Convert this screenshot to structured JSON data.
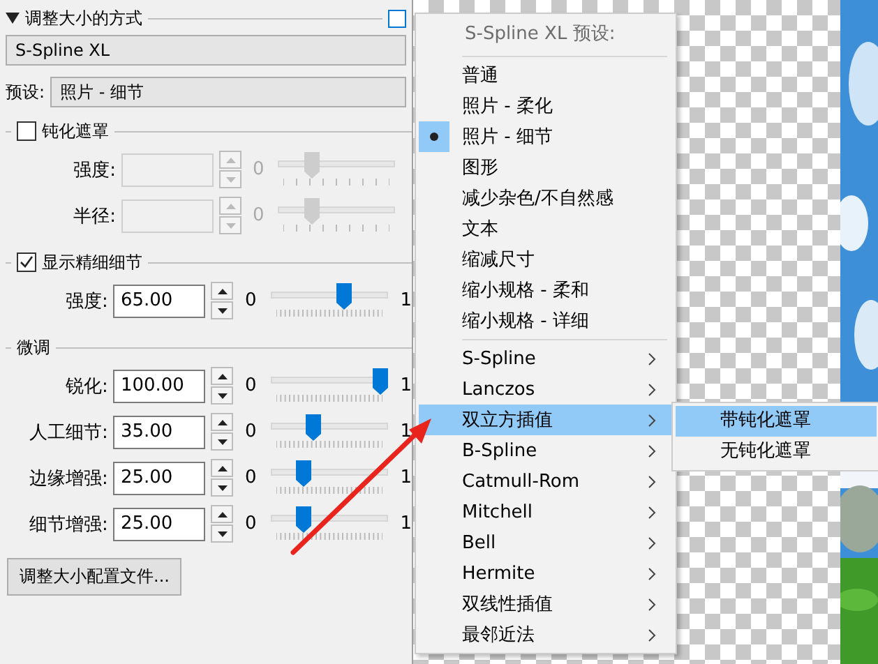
{
  "resize_method": {
    "title": "调整大小的方式",
    "method": "S-Spline XL"
  },
  "preset": {
    "label": "预设:",
    "value": "照片 - 细节"
  },
  "groups": [
    {
      "kind": "checkbox",
      "title": "钝化遮罩",
      "checked": false,
      "params": [
        {
          "label": "强度:",
          "min": "0",
          "level": 0.25,
          "disabled": true
        },
        {
          "label": "半径:",
          "min": "0",
          "level": 0.25,
          "disabled": true
        }
      ]
    },
    {
      "kind": "checkbox",
      "title": "显示精细细节",
      "checked": true,
      "params": [
        {
          "label": "强度:",
          "value": "65.00",
          "min": "0",
          "max": "1",
          "level": 0.65,
          "disabled": false
        }
      ]
    },
    {
      "kind": "plain",
      "title": "微调",
      "params": [
        {
          "label": "锐化:",
          "value": "100.00",
          "min": "0",
          "max": "1",
          "level": 1.0,
          "disabled": false
        },
        {
          "label": "人工细节:",
          "value": "35.00",
          "min": "0",
          "max": "1",
          "level": 0.35,
          "disabled": false
        },
        {
          "label": "边缘增强:",
          "value": "25.00",
          "min": "0",
          "max": "1",
          "level": 0.25,
          "disabled": false
        },
        {
          "label": "细节增强:",
          "value": "25.00",
          "min": "0",
          "max": "1",
          "level": 0.25,
          "disabled": false
        }
      ]
    }
  ],
  "profile_button": "调整大小配置文件...",
  "menu": {
    "header": "S-Spline XL 预设:",
    "sections": [
      {
        "kind": "presets",
        "items": [
          {
            "label": "普通",
            "selected": false
          },
          {
            "label": "照片 - 柔化",
            "selected": false
          },
          {
            "label": "照片 - 细节",
            "selected": true
          },
          {
            "label": "图形",
            "selected": false
          },
          {
            "label": "减少杂色/不自然感",
            "selected": false
          },
          {
            "label": "文本",
            "selected": false
          },
          {
            "label": "缩减尺寸",
            "selected": false
          },
          {
            "label": "缩小规格 - 柔和",
            "selected": false
          },
          {
            "label": "缩小规格 - 详细",
            "selected": false
          }
        ]
      },
      {
        "kind": "algorithms",
        "items": [
          {
            "label": "S-Spline",
            "highlighted": false
          },
          {
            "label": "Lanczos",
            "highlighted": false
          },
          {
            "label": "双立方插值",
            "highlighted": true
          },
          {
            "label": "B-Spline",
            "highlighted": false
          },
          {
            "label": "Catmull-Rom",
            "highlighted": false
          },
          {
            "label": "Mitchell",
            "highlighted": false
          },
          {
            "label": "Bell",
            "highlighted": false
          },
          {
            "label": "Hermite",
            "highlighted": false
          },
          {
            "label": "双线性插值",
            "highlighted": false
          },
          {
            "label": "最邻近法",
            "highlighted": false
          }
        ]
      }
    ],
    "submenu": [
      {
        "label": "带钝化遮罩",
        "highlighted": true
      },
      {
        "label": "无钝化遮罩",
        "highlighted": false
      }
    ]
  }
}
